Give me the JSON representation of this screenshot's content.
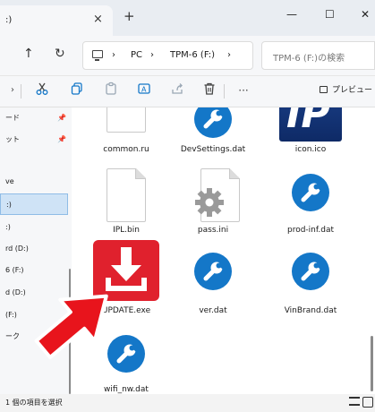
{
  "tab": {
    "title": ":)",
    "close_glyph": "×",
    "new_tab_glyph": "+"
  },
  "window": {
    "minimize_glyph": "—",
    "maximize_glyph": "☐",
    "close_glyph": "✕"
  },
  "nav": {
    "up_glyph": "↑",
    "refresh_glyph": "↻"
  },
  "address": {
    "icon": "pc-icon",
    "crumbs": [
      "PC",
      "TPM-6 (F:)"
    ],
    "separator": "›"
  },
  "search": {
    "placeholder": "TPM-6 (F:)の検索"
  },
  "toolbar": {
    "preview_label": "プレビュー",
    "more_glyph": "···",
    "icons": [
      "cut-icon",
      "copy-icon",
      "paste-icon",
      "rename-icon",
      "share-icon",
      "delete-icon"
    ]
  },
  "sidebar": {
    "items": [
      {
        "label": "ード",
        "pinned": true
      },
      {
        "label": "ット",
        "pinned": true
      },
      {
        "label": "ve",
        "pinned": false
      },
      {
        "label": ":)",
        "pinned": false,
        "selected": true
      },
      {
        "label": ":)",
        "pinned": false
      },
      {
        "label": "rd (D:)",
        "pinned": false
      },
      {
        "label": "6 (F:)",
        "pinned": false
      },
      {
        "label": "d (D:)",
        "pinned": false
      },
      {
        "label": "(F:)",
        "pinned": false
      },
      {
        "label": "ーク",
        "pinned": false
      }
    ],
    "pin_glyph": "📌"
  },
  "files": [
    {
      "name": "common.ru",
      "type": "doc"
    },
    {
      "name": "DevSettings.dat",
      "type": "config"
    },
    {
      "name": "icon.ico",
      "type": "ip-logo"
    },
    {
      "name": "IPL.bin",
      "type": "doc"
    },
    {
      "name": "pass.ini",
      "type": "ini"
    },
    {
      "name": "prod-inf.dat",
      "type": "config"
    },
    {
      "name": "UPDATE.exe",
      "type": "update-exe"
    },
    {
      "name": "ver.dat",
      "type": "config"
    },
    {
      "name": "VinBrand.dat",
      "type": "config"
    },
    {
      "name": "wifi_nw.dat",
      "type": "config"
    }
  ],
  "ip_logo_text": "IP",
  "status": {
    "text": "1 個の項目を選択"
  },
  "colors": {
    "accent_blue": "#1477c8",
    "update_red": "#e0212d",
    "selection": "#cfe3f6",
    "pointer_red": "#e8141c"
  }
}
